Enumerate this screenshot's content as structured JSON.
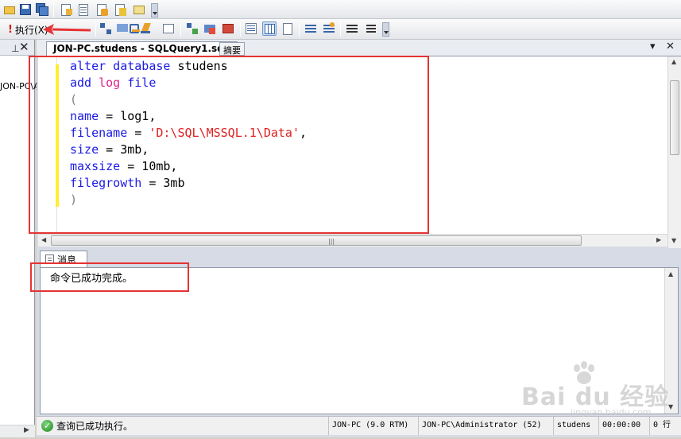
{
  "toolbar": {
    "execute_label": "执行(X)",
    "execute_icon": "exclamation-icon"
  },
  "left_panel": {
    "pin_glyph": "ᅟ",
    "close_glyph": "✕",
    "tree_item": "JON-PC\\A"
  },
  "tabs": {
    "active_tab": "JON-PC.studens - SQLQuery1.sql*",
    "summary_tab": "摘要"
  },
  "editor": {
    "lines": [
      {
        "tokens": [
          {
            "t": "alter database",
            "c": "kw"
          },
          {
            "t": " studens",
            "c": "pl"
          }
        ]
      },
      {
        "tokens": [
          {
            "t": "add",
            "c": "kw"
          },
          {
            "t": " ",
            "c": "pl"
          },
          {
            "t": "log",
            "c": "fn"
          },
          {
            "t": " file",
            "c": "kw"
          }
        ]
      },
      {
        "tokens": [
          {
            "t": "(",
            "c": "gr"
          }
        ]
      },
      {
        "tokens": [
          {
            "t": "name",
            "c": "kw"
          },
          {
            "t": " = log1,",
            "c": "pl"
          }
        ]
      },
      {
        "tokens": [
          {
            "t": "filename",
            "c": "kw"
          },
          {
            "t": " = ",
            "c": "pl"
          },
          {
            "t": "'D:\\SQL\\MSSQL.1\\Data'",
            "c": "str"
          },
          {
            "t": ",",
            "c": "pl"
          }
        ]
      },
      {
        "tokens": [
          {
            "t": "size",
            "c": "kw"
          },
          {
            "t": " = 3mb,",
            "c": "pl"
          }
        ]
      },
      {
        "tokens": [
          {
            "t": "maxsize",
            "c": "kw"
          },
          {
            "t": " = 10mb,",
            "c": "pl"
          }
        ]
      },
      {
        "tokens": [
          {
            "t": "filegrowth",
            "c": "kw"
          },
          {
            "t": " = 3mb",
            "c": "pl"
          }
        ]
      },
      {
        "tokens": [
          {
            "t": ")",
            "c": "gr"
          }
        ]
      }
    ]
  },
  "results": {
    "tab_label": "消息",
    "message": "命令已成功完成。"
  },
  "status": {
    "message": "查询已成功执行。",
    "server": "JON-PC (9.0 RTM)",
    "user": "JON-PC\\Administrator (52)",
    "database": "studens",
    "elapsed": "00:00:00",
    "rows": "0 行"
  },
  "watermark": {
    "brand": "Bai du 经验",
    "url": "jingyan.baidu.com"
  },
  "colors": {
    "keyword": "#1a1ae6",
    "function": "#e0218a",
    "string": "#e02020",
    "annotation": "#e53333",
    "change_bar": "#ffee32"
  }
}
